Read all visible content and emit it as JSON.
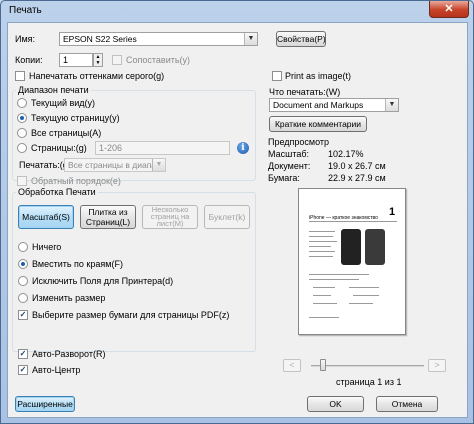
{
  "window": {
    "title": "Печать",
    "close_label": "✕"
  },
  "printer": {
    "name_label": "Имя:",
    "name_value": "EPSON S22 Series",
    "properties_button": "Свойства(P)",
    "copies_label": "Копии:",
    "copies_value": "1",
    "collate_label": "Сопоставить(y)",
    "grayscale_label": "Напечатать оттенками серого(g)",
    "print_as_image_label": "Print as image(t)"
  },
  "range": {
    "title": "Диапазон печати",
    "current_view": "Текущий вид(y)",
    "current_page": "Текущую страницу(y)",
    "all_pages": "Все страницы(A)",
    "pages_label": "Страницы:(g)",
    "pages_value": "1-206",
    "print_label": "Печатать:(g)",
    "print_value": "Все страницы в диапазо",
    "reverse_label": "Обратный порядок(e)"
  },
  "what": {
    "title": "Что печатать:(W)",
    "value": "Document and Markups",
    "summarize_button": "Краткие комментарии"
  },
  "preview": {
    "title": "Предпросмотр",
    "scale_label": "Масштаб:",
    "scale_value": "102.17%",
    "document_label": "Документ:",
    "document_value": "19.0 x 26.7 см",
    "paper_label": "Бумага:",
    "paper_value": "22.9 x 27.9 см",
    "page_counter": "страница 1 из 1",
    "page_number": "1",
    "page_heading": "iPhone — краткое знакомство"
  },
  "handling": {
    "title": "Обработка Печати",
    "tabs": [
      {
        "label": "Масштаб(S)"
      },
      {
        "label": "Плитка из Страниц(L)"
      },
      {
        "label": "Несколько страниц на лист(M)"
      },
      {
        "label": "Буклет(k)"
      }
    ],
    "none_label": "Ничего",
    "fit_label": "Вместить по краям(F)",
    "exclude_label": "Исключить Поля для Принтера(d)",
    "resize_label": "Изменить размер",
    "choose_paper_label": "Выберите размер бумаги для страницы PDF(z)"
  },
  "options": {
    "auto_rotate": "Авто-Разворот(R)",
    "auto_center": "Авто-Центр"
  },
  "footer": {
    "advanced_button": "Расширенные",
    "ok_button": "OK",
    "cancel_button": "Отмена"
  },
  "colors": {
    "accent": "#3c7fb1",
    "title_bg": "#bcd1ea",
    "close_red": "#c7432a"
  }
}
